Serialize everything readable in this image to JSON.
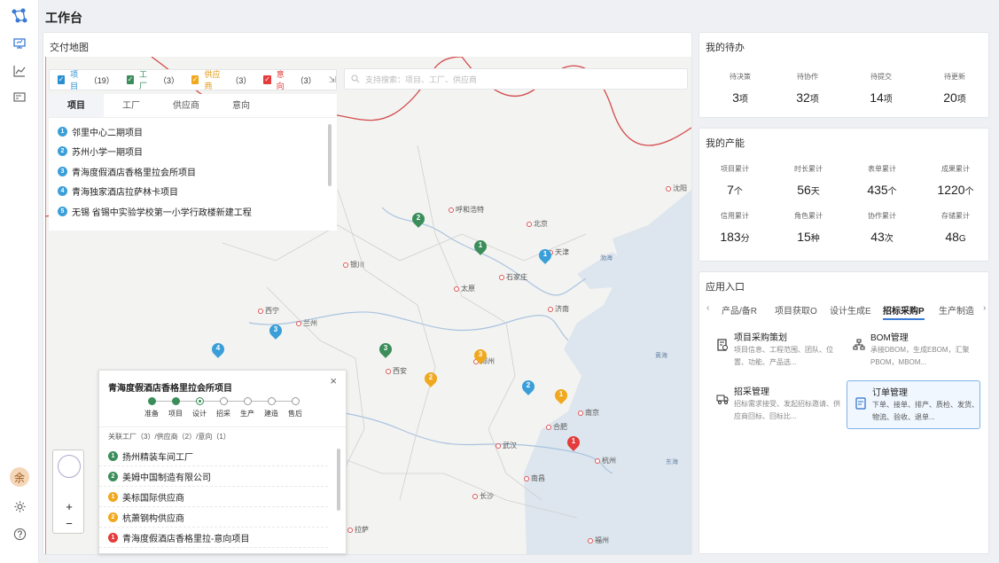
{
  "page_title": "工作台",
  "rail": {
    "avatar_text": "余"
  },
  "map_card": {
    "title": "交付地图",
    "filters": [
      {
        "label": "项目",
        "count": "（19）",
        "color": "#2a8fd0"
      },
      {
        "label": "工厂",
        "count": "（3）",
        "color": "#3b8d5a"
      },
      {
        "label": "供应商",
        "count": "（3）",
        "color": "#f0a81e"
      },
      {
        "label": "意向",
        "count": "（3）",
        "color": "#e43b3b"
      }
    ],
    "search_placeholder": "支持搜索：项目、工厂、供应商",
    "tabs": [
      "项目",
      "工厂",
      "供应商",
      "意向"
    ],
    "projects": [
      {
        "num": "1",
        "name": "邻里中心二期项目"
      },
      {
        "num": "2",
        "name": "苏州小学一期项目"
      },
      {
        "num": "3",
        "name": "青海度假酒店香格里拉会所项目"
      },
      {
        "num": "4",
        "name": "青海独家酒店拉萨林卡项目"
      },
      {
        "num": "5",
        "name": "无锡 省锡中实验学校第一小学行政楼新建工程"
      }
    ],
    "cities": [
      "呼和浩特",
      "北京",
      "天津",
      "沈阳",
      "太原",
      "石家庄",
      "银川",
      "济南",
      "西宁",
      "兰州",
      "郑州",
      "西安",
      "南京",
      "合肥",
      "武汉",
      "杭州",
      "长沙",
      "南昌",
      "福州",
      "拉萨"
    ],
    "seas": [
      "渤海",
      "黄海",
      "东海"
    ],
    "pins": [
      {
        "num": "2",
        "type": "green"
      },
      {
        "num": "1",
        "type": "green"
      },
      {
        "num": "1",
        "type": "blue"
      },
      {
        "num": "3",
        "type": "blue"
      },
      {
        "num": "4",
        "type": "blue"
      },
      {
        "num": "3",
        "type": "green"
      },
      {
        "num": "3",
        "type": "orange"
      },
      {
        "num": "2",
        "type": "orange"
      },
      {
        "num": "2",
        "type": "blue"
      },
      {
        "num": "1",
        "type": "orange"
      },
      {
        "num": "1",
        "type": "red"
      }
    ],
    "popup": {
      "title": "青海度假酒店香格里拉会所项目",
      "stages": [
        "准备",
        "项目",
        "设计",
        "招采",
        "生产",
        "建造",
        "售后"
      ],
      "completed_stages": 2,
      "current_stage": 3,
      "summary": "关联工厂（3）/供应商（2）/意向（1）",
      "related": [
        {
          "num": "1",
          "type": "green",
          "name": "扬州精装车间工厂"
        },
        {
          "num": "2",
          "type": "green",
          "name": "美姆中国制造有限公司"
        },
        {
          "num": "1",
          "type": "orange",
          "name": "美标国际供应商"
        },
        {
          "num": "2",
          "type": "orange",
          "name": "杭萧钢构供应商"
        },
        {
          "num": "1",
          "type": "red",
          "name": "青海度假酒店香格里拉-意向项目"
        }
      ]
    }
  },
  "todo": {
    "title": "我的待办",
    "items": [
      {
        "label": "待决策",
        "value": "3",
        "unit": "项"
      },
      {
        "label": "待协作",
        "value": "32",
        "unit": "项"
      },
      {
        "label": "待提交",
        "value": "14",
        "unit": "项"
      },
      {
        "label": "待更新",
        "value": "20",
        "unit": "项"
      }
    ]
  },
  "capacity": {
    "title": "我的产能",
    "items": [
      {
        "label": "项目累计",
        "value": "7",
        "unit": "个"
      },
      {
        "label": "时长累计",
        "value": "56",
        "unit": "天"
      },
      {
        "label": "表单累计",
        "value": "435",
        "unit": "个"
      },
      {
        "label": "成果累计",
        "value": "1220",
        "unit": "个"
      },
      {
        "label": "信用累计",
        "value": "183",
        "unit": "分"
      },
      {
        "label": "角色累计",
        "value": "15",
        "unit": "种"
      },
      {
        "label": "协作累计",
        "value": "43",
        "unit": "次"
      },
      {
        "label": "存储累计",
        "value": "48",
        "unit": "G"
      }
    ]
  },
  "apps": {
    "title": "应用入口",
    "tabs": [
      "产品/备R",
      "项目获取O",
      "设计生成E",
      "招标采购P",
      "生产制造"
    ],
    "active_tab": 3,
    "entries": [
      {
        "title": "项目采购策划",
        "desc": "项目信息、工程范围、团队、位置、功能、产品选...",
        "icon": "plan-icon"
      },
      {
        "title": "BOM管理",
        "desc": "承接DBOM，生成EBOM，汇聚PBOM，MBOM...",
        "icon": "bom-icon"
      },
      {
        "title": "招采管理",
        "desc": "招标需求接受、发起招标邀请、供应商回标、回标比...",
        "icon": "truck-icon"
      },
      {
        "title": "订单管理",
        "desc": "下单、接单、排产、质检、发货、物流、验收、退单...",
        "icon": "order-icon"
      }
    ]
  }
}
